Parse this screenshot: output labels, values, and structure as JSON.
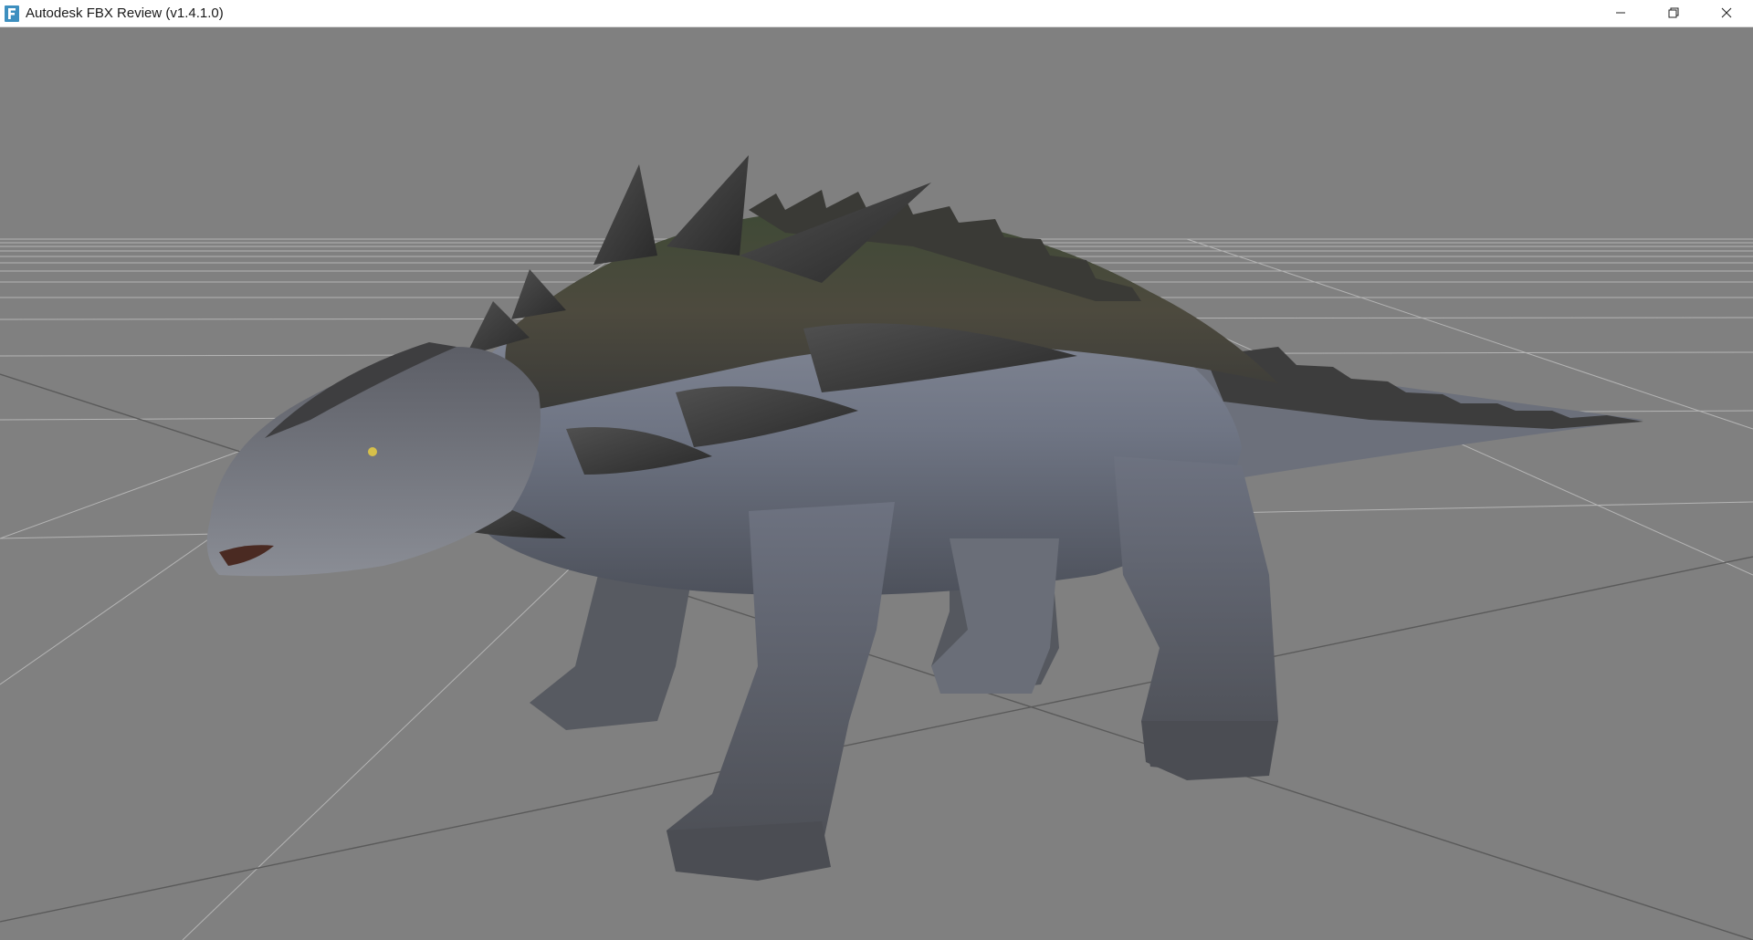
{
  "window": {
    "title": "Autodesk FBX Review (v1.4.1.0)",
    "app_icon": "fbx-review-app-icon",
    "controls": {
      "minimize_icon": "minimize-icon",
      "restore_icon": "restore-icon",
      "close_icon": "close-icon"
    }
  },
  "viewport": {
    "background_color": "#808080",
    "grid_color": "#b0b0b0",
    "axis_color": "#4a4a4a",
    "model_name": "ankylosaur-model"
  }
}
